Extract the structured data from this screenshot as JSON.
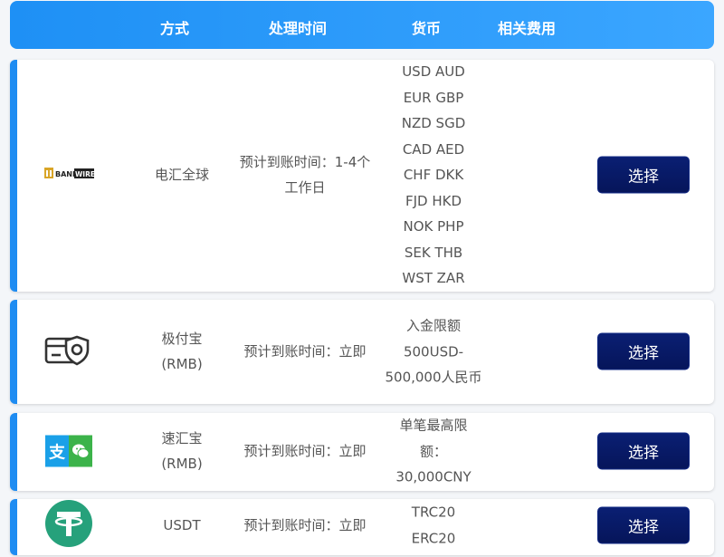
{
  "header": {
    "method": "方式",
    "time": "处理时间",
    "currency": "货币",
    "fee": "相关费用"
  },
  "rows": [
    {
      "logo_icon": "bankwire-logo-icon",
      "logo_text": "BANKWIRE",
      "method": "电汇全球",
      "time": "预计到账时间：1-4个工作日",
      "currency": "USD AUD\nEUR GBP\nNZD SGD\nCAD AED\nCHF DKK\nFJD HKD\nNOK PHP\nSEK THB\nWST ZAR",
      "button": "选择"
    },
    {
      "logo_icon": "card-shield-icon",
      "method": "极付宝(RMB)",
      "time": "预计到账时间：立即",
      "currency": "入金限额500USD-500,000人民币",
      "button": "选择"
    },
    {
      "logo_icon": "alipay-wechat-icon",
      "logo_text": "支",
      "method": "速汇宝(RMB)",
      "time": "预计到账时间：立即",
      "currency": "单笔最高限额：30,000CNY",
      "button": "选择"
    },
    {
      "logo_icon": "tether-icon",
      "method": "USDT",
      "time": "预计到账时间：立即",
      "currency": "TRC20\nERC20",
      "button": "选择"
    }
  ],
  "colors": {
    "header": "#1e90f5",
    "accent_border": "#1e8cf2",
    "button": "#0a1f73",
    "tether": "#26a17b",
    "alipay": "#1aa0e8",
    "wechat": "#3cb34a"
  }
}
